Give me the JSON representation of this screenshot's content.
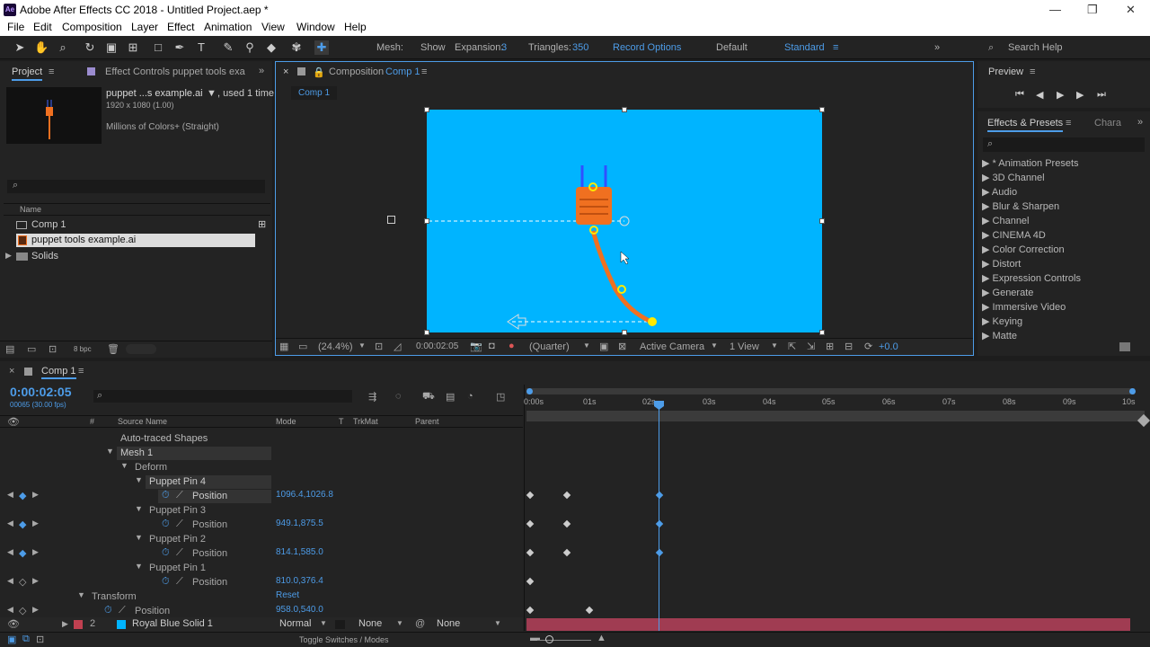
{
  "app": {
    "logo": "Ae",
    "title": "Adobe After Effects CC 2018 - Untitled Project.aep *"
  },
  "window_controls": {
    "minimize": "—",
    "maximize": "❐",
    "close": "✕"
  },
  "menu": [
    "File",
    "Edit",
    "Composition",
    "Layer",
    "Effect",
    "Animation",
    "View",
    "Window",
    "Help"
  ],
  "toolbar": {
    "mesh_label": "Mesh:",
    "show_label": "Show",
    "expansion_label": "Expansion:",
    "expansion_value": "3",
    "triangles_label": "Triangles:",
    "triangles_value": "350",
    "record_options": "Record Options",
    "workspace_default": "Default",
    "workspace_standard": "Standard",
    "search_help": "Search Help"
  },
  "project": {
    "tab": "Project",
    "effect_controls_tab": "Effect Controls puppet tools exa",
    "item_name": "puppet ...s example.ai",
    "used": ", used 1 time",
    "dims": "1920 x 1080 (1.00)",
    "colors": "Millions of Colors+ (Straight)",
    "col_name": "Name",
    "items": [
      "Comp 1",
      "puppet tools example.ai",
      "Solids"
    ],
    "bpc": "8 bpc"
  },
  "composition": {
    "tab_label": "Composition",
    "tab_name": "Comp 1",
    "breadcrumb": "Comp 1",
    "zoom": "(24.4%)",
    "timecode": "0:00:02:05",
    "resolution": "(Quarter)",
    "camera": "Active Camera",
    "views": "1 View",
    "exposure": "+0.0"
  },
  "preview": {
    "tab": "Preview"
  },
  "effects": {
    "tab": "Effects & Presets",
    "tab2": "Chara",
    "items": [
      "* Animation Presets",
      "3D Channel",
      "Audio",
      "Blur & Sharpen",
      "Channel",
      "CINEMA 4D",
      "Color Correction",
      "Distort",
      "Expression Controls",
      "Generate",
      "Immersive Video",
      "Keying",
      "Matte"
    ]
  },
  "timeline": {
    "tab": "Comp 1",
    "timecode": "0:00:02:05",
    "fps": "00065 (30.00 fps)",
    "cols": {
      "num": "#",
      "source": "Source Name",
      "mode": "Mode",
      "t": "T",
      "trkmat": "TrkMat",
      "parent": "Parent"
    },
    "rows": [
      {
        "label": "Auto-traced Shapes",
        "value": ""
      },
      {
        "label": "Mesh 1",
        "value": ""
      },
      {
        "label": "Deform",
        "value": ""
      },
      {
        "label": "Puppet Pin 4",
        "value": ""
      },
      {
        "label": "Position",
        "value": "1096.4,1026.8"
      },
      {
        "label": "Puppet Pin 3",
        "value": ""
      },
      {
        "label": "Position",
        "value": "949.1,875.5"
      },
      {
        "label": "Puppet Pin 2",
        "value": ""
      },
      {
        "label": "Position",
        "value": "814.1,585.0"
      },
      {
        "label": "Puppet Pin 1",
        "value": ""
      },
      {
        "label": "Position",
        "value": "810.0,376.4"
      },
      {
        "label": "Transform",
        "value": "Reset"
      },
      {
        "label": "Position",
        "value": "958.0,540.0"
      }
    ],
    "layer2": {
      "num": "2",
      "name": "Royal Blue Solid 1",
      "mode": "Normal",
      "trkmat": "None",
      "parent": "None"
    },
    "ruler": [
      "0:00s",
      "01s",
      "02s",
      "03s",
      "04s",
      "05s",
      "06s",
      "07s",
      "08s",
      "09s",
      "10s"
    ],
    "toggle": "Toggle Switches / Modes"
  },
  "colors": {
    "accent": "#4d9ce8",
    "canvas": "#00b4ff",
    "plug": "#f07020",
    "layer_bar": "#a03c52"
  }
}
